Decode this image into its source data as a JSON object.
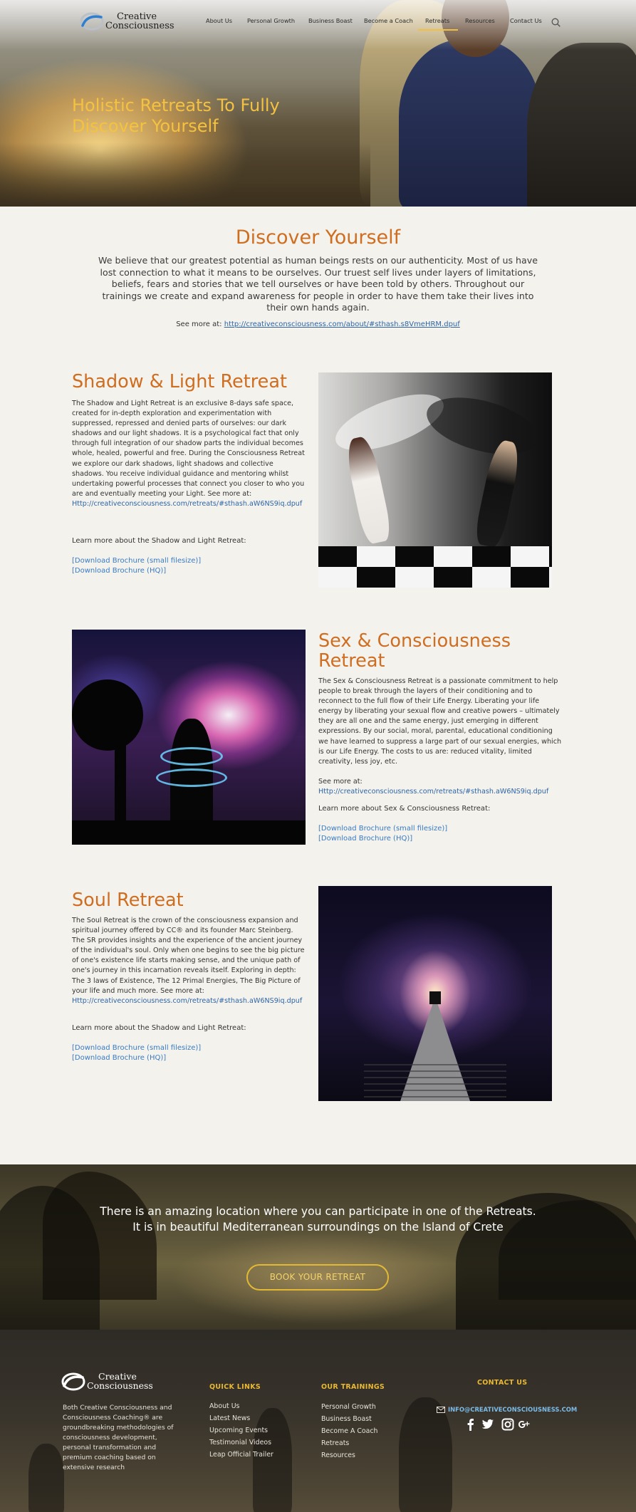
{
  "header": {
    "logo_line1": "Creative",
    "logo_line2": "Consciousness",
    "menu": [
      "About Us",
      "Personal Growth",
      "Business Boast",
      "Become a Coach",
      "Retreats",
      "Resources",
      "Contact Us"
    ],
    "active_menu": "Retreats"
  },
  "hero": {
    "title_line1": "Holistic Retreats To Fully",
    "title_line2": "Discover Yourself"
  },
  "intro": {
    "title": "Discover Yourself",
    "text": "We believe that our greatest potential as human beings rests on our authenticity. Most of us have lost connection to what it means to be ourselves. Our truest self lives under layers of limitations, beliefs, fears and stories that we tell ourselves or have been told by others. Throughout our trainings we create and expand awareness for people in order to have them take their lives into their own hands again.",
    "see_more_label": "See more at:",
    "see_more_url": "http://creativeconsciousness.com/about/#sthash.s8VmeHRM.dpuf"
  },
  "retreats": [
    {
      "title": "Shadow & Light Retreat",
      "body": "The Shadow and Light Retreat is an exclusive 8-days safe space, created for in-depth exploration and experimentation with suppressed, repressed and denied parts of ourselves: our dark shadows and our light shadows. It is a psychological fact that only through full integration of our shadow parts the individual becomes whole, healed, powerful and free. During the Consciousness Retreat we explore our dark shadows, light shadows and collective shadows. You receive individual guidance and mentoring whilst undertaking powerful processes that connect you closer to who you are and eventually meeting your Light. See more at:",
      "link": "Http://creativeconsciousness.com/retreats/#sthash.aW6NS9iq.dpuf",
      "learn": "Learn more about the Shadow and Light Retreat:",
      "dl_small": "[Download Brochure (small filesize)]",
      "dl_hq": "[Download Brochure (HQ)]"
    },
    {
      "title": "Sex & Consciousness Retreat",
      "body": "The Sex & Consciousness Retreat is a passionate commitment to help people to break through the layers of their conditioning and to reconnect to the full flow of their Life Energy. Liberating your life energy by liberating your sexual flow and creative powers – ultimately they are all one and the same energy, just emerging in different expressions. By our social, moral, parental, educational conditioning we have learned to suppress a large part of our sexual energies, which is our Life Energy. The costs to us are: reduced vitality, limited creativity, less joy, etc.",
      "see_more": "See more at:",
      "link": "Http://creativeconsciousness.com/retreats/#sthash.aW6NS9iq.dpuf",
      "learn": "Learn more about Sex & Consciousness Retreat:",
      "dl_small": "[Download Brochure (small filesize)]",
      "dl_hq": "[Download Brochure (HQ)]"
    },
    {
      "title": "Soul Retreat",
      "body": "The Soul Retreat is the crown of the consciousness expansion and spiritual journey offered by CC® and its founder Marc Steinberg. The SR provides insights and the experience of the ancient journey of the individual's soul. Only when one begins to see the big picture of one's existence life starts making sense, and the unique path of one's journey in this incarnation reveals itself. Exploring in depth: The 3 laws of Existence, The 12 Primal Energies, The Big Picture of your life and much more. See more at:",
      "link": "Http://creativeconsciousness.com/retreats/#sthash.aW6NS9iq.dpuf",
      "learn": "Learn more about the Shadow and Light Retreat:",
      "dl_small": "[Download Brochure (small filesize)]",
      "dl_hq": "[Download Brochure (HQ)]"
    }
  ],
  "location": {
    "text": "There is an amazing location where you can participate in one of the Retreats. It is in beautiful Mediterranean surroundings on the Island of Crete",
    "button": "BOOK YOUR RETREAT"
  },
  "footer": {
    "logo_line1": "Creative",
    "logo_line2": "Consciousness",
    "about": "Both Creative Consciousness and Consciousness Coaching® are groundbreaking methodologies of consciousness development, personal transformation and premium coaching based on extensive research",
    "quick_links_title": "QUICK LINKS",
    "quick_links": [
      "About Us",
      "Latest News",
      "Upcoming Events",
      "Testimonial Videos",
      "Leap Official Trailer"
    ],
    "trainings_title": "OUR TRAININGS",
    "trainings": [
      "Personal Growth",
      "Business Boast",
      "Become A Coach",
      "Retreats",
      "Resources"
    ],
    "contact_title": "CONTACT US",
    "email": "INFO@CREATIVECONSCIOUSNESS.COM",
    "social_icons": [
      "facebook-icon",
      "twitter-icon",
      "instagram-icon",
      "google-plus-icon"
    ]
  },
  "colors": {
    "accent_orange": "#cf6d21",
    "accent_gold": "#f4c240",
    "link_blue": "#2f65a6",
    "page_bg": "#f3f2ec"
  }
}
